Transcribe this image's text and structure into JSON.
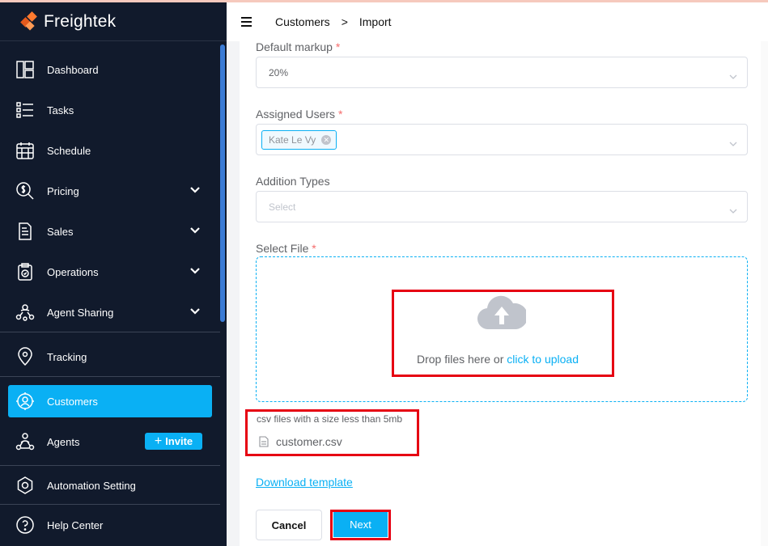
{
  "app": {
    "name": "Freightek"
  },
  "header": {
    "crumbs": [
      "Customers",
      ">",
      "Import"
    ]
  },
  "sidebar": {
    "items": [
      {
        "label": "Dashboard",
        "icon": "dashboard-icon"
      },
      {
        "label": "Tasks",
        "icon": "tasks-icon"
      },
      {
        "label": "Schedule",
        "icon": "calendar-icon"
      },
      {
        "label": "Pricing",
        "icon": "pricing-icon",
        "expandable": true
      },
      {
        "label": "Sales",
        "icon": "sales-icon",
        "expandable": true
      },
      {
        "label": "Operations",
        "icon": "operations-icon",
        "expandable": true
      },
      {
        "label": "Agent Sharing",
        "icon": "agent-sharing-icon",
        "expandable": true
      },
      {
        "label": "Tracking",
        "icon": "tracking-icon"
      },
      {
        "label": "Customers",
        "icon": "customers-icon",
        "active": true
      },
      {
        "label": "Agents",
        "icon": "agents-icon"
      },
      {
        "label": "Automation Setting",
        "icon": "automation-icon"
      },
      {
        "label": "Help Center",
        "icon": "help-icon"
      }
    ],
    "invite_label": "Invite",
    "invite_plus": "+"
  },
  "form": {
    "default_markup": {
      "label": "Default markup",
      "required": "*",
      "value": "20%"
    },
    "assigned_users": {
      "label": "Assigned Users",
      "required": "*",
      "tags": [
        "Kate Le Vy"
      ]
    },
    "addition_types": {
      "label": "Addition Types",
      "placeholder": "Select"
    },
    "select_file": {
      "label": "Select File",
      "required": "*",
      "drop_text": "Drop files here or ",
      "click_text": "click to upload",
      "tip": "csv files with a size less than 5mb",
      "file_name": "customer.csv"
    },
    "download_template": "Download template",
    "cancel_label": "Cancel",
    "next_label": "Next"
  },
  "colors": {
    "sidebar_bg": "#111a2c",
    "accent": "#0ab0f4",
    "highlight": "#e60012",
    "required": "#f56c6c"
  }
}
